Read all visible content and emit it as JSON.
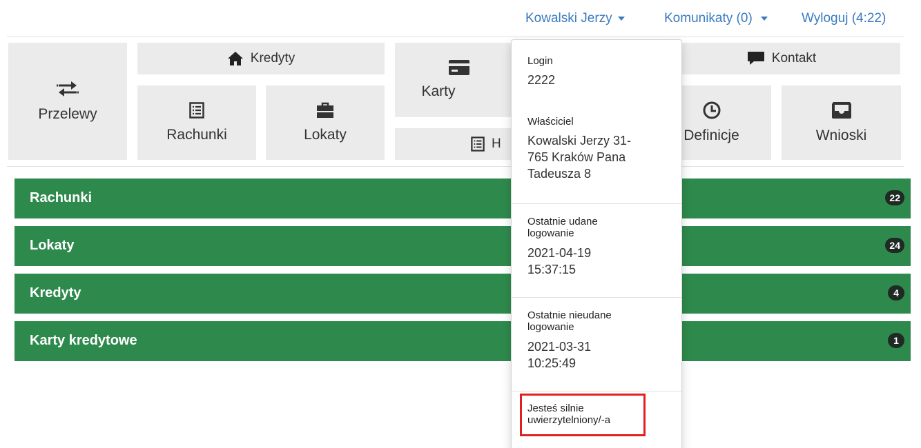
{
  "topbar": {
    "user_label": "Kowalski Jerzy",
    "messages_label": "Komunikaty (0)",
    "logout_label": "Wyloguj (4:22)"
  },
  "tiles": {
    "przelewy": "Przelewy",
    "kredyty": "Kredyty",
    "rachunki": "Rachunki",
    "lokaty": "Lokaty",
    "karty": "Karty",
    "historia_partial": "H",
    "kontakt": "Kontakt",
    "definicje": "Definicje",
    "wnioski": "Wnioski"
  },
  "bars": [
    {
      "label": "Rachunki",
      "count": "22"
    },
    {
      "label": "Lokaty",
      "count": "24"
    },
    {
      "label": "Kredyty",
      "count": "4"
    },
    {
      "label": "Karty kredytowe",
      "count": "1"
    }
  ],
  "dropdown": {
    "login_label": "Login",
    "login_value": "2222",
    "owner_label": "Właściciel",
    "owner_line1": "Kowalski Jerzy 31-",
    "owner_line2": "765 Kraków Pana",
    "owner_line3": "Tadeusza 8",
    "last_ok_label1": "Ostatnie udane",
    "last_ok_label2": "logowanie",
    "last_ok_date": "2021-04-19",
    "last_ok_time": "15:37:15",
    "last_fail_label1": "Ostatnie nieudane",
    "last_fail_label2": "logowanie",
    "last_fail_date": "2021-03-31",
    "last_fail_time": "10:25:49",
    "auth_line1": "Jesteś silnie",
    "auth_line2": "uwierzytelniony/-a"
  },
  "colors": {
    "link": "#3a7bbf",
    "tile_bg": "#ebebeb",
    "bar_green": "#2e8a4c",
    "badge_bg": "#1f2a24",
    "highlight": "#e02020"
  }
}
